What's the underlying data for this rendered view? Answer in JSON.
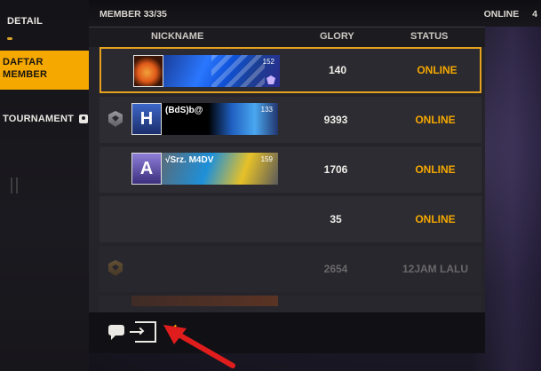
{
  "left_nav": {
    "items": [
      {
        "label": "DETAIL"
      },
      {
        "label": "DAFTAR MEMBER",
        "line1": "DAFTAR",
        "line2": "MEMBER",
        "selected": true
      },
      {
        "label": "TOURNAMENT"
      }
    ]
  },
  "infobar": {
    "member_label": "MEMBER",
    "member_count": "33/35",
    "online_label": "ONLINE",
    "online_count": "4"
  },
  "table": {
    "headers": {
      "nickname": "NICKNAME",
      "glory": "GLORY",
      "status": "STATUS"
    },
    "rows": [
      {
        "nickname": "",
        "level": "152",
        "glory": "140",
        "status": "ONLINE"
      },
      {
        "nickname": "(BdS)b@",
        "level": "133",
        "glory": "9393",
        "status": "ONLINE"
      },
      {
        "nickname": "√Srz. M4DV",
        "level": "159",
        "glory": "1706",
        "status": "ONLINE"
      },
      {
        "nickname": "",
        "glory": "35",
        "status": "ONLINE"
      },
      {
        "nickname": "",
        "glory": "2654",
        "status": "12JAM LALU"
      }
    ]
  },
  "toolbar": {
    "icons": [
      "chat-icon",
      "exit-icon",
      "collapse-icon"
    ]
  },
  "colors": {
    "accent": "#f5a800",
    "selected_border": "#e6a11e",
    "annotation_arrow": "#e01d1d"
  }
}
